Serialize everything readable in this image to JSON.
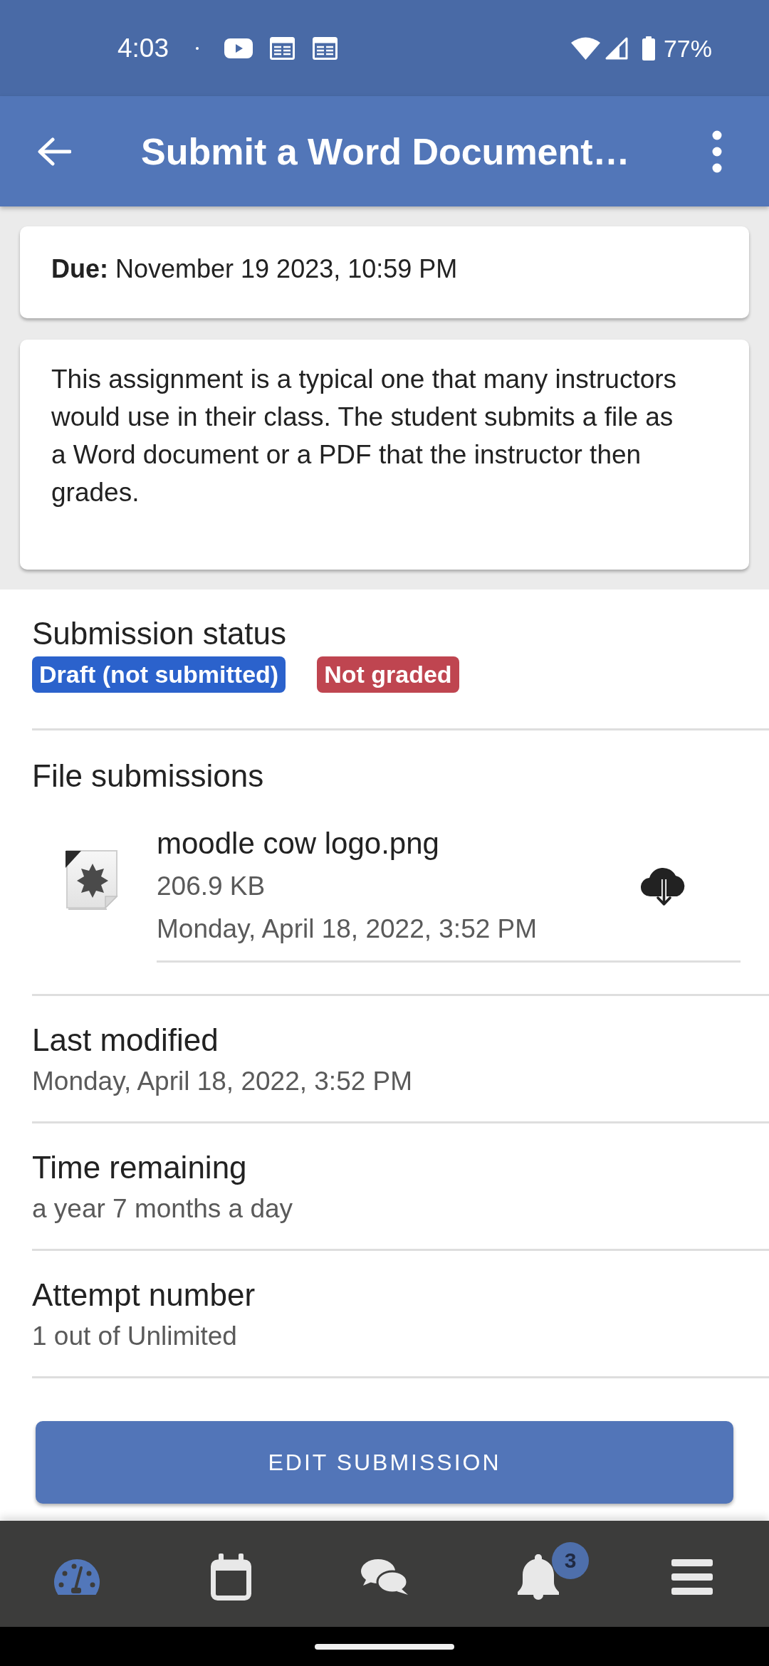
{
  "status_bar": {
    "time": "4:03",
    "battery": "77%"
  },
  "app_bar": {
    "title": "Submit a Word Document…"
  },
  "due": "**Due:** November 19 2023, 10:59 PM",
  "description": "This assignment is a typical one that many instructors would use in their class. The student submits a file as a Word document or a PDF that the instructor then grades.",
  "submission_status": {
    "label": "Submission status",
    "badges": [
      {
        "text": "Draft (not submitted)",
        "color": "#2b62cc"
      },
      {
        "text": "Not graded",
        "color": "#bf4550"
      }
    ]
  },
  "file_submissions": {
    "label": "File submissions",
    "files": [
      {
        "name": "moodle cow logo.png",
        "size": "206.9 KB",
        "date": "Monday, April 18, 2022, 3:52 PM"
      }
    ]
  },
  "details": [
    {
      "label": "Last modified",
      "value": "Monday, April 18, 2022, 3:52 PM"
    },
    {
      "label": "Time remaining",
      "value": "a year 7 months a day"
    },
    {
      "label": "Attempt number",
      "value": "1 out of Unlimited"
    }
  ],
  "button": {
    "label": "EDIT SUBMISSION"
  },
  "bottom_nav": [
    {
      "kind": "dashboard",
      "selected": true
    },
    {
      "kind": "calendar",
      "selected": false
    },
    {
      "kind": "messages",
      "selected": false
    },
    {
      "kind": "notifications",
      "selected": false,
      "badge": "3"
    },
    {
      "kind": "menu",
      "selected": false
    }
  ]
}
